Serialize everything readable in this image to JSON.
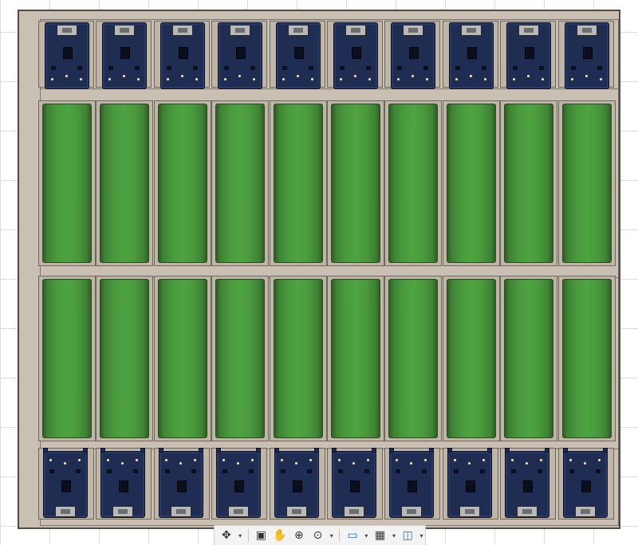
{
  "app": {
    "name": "CAD viewport",
    "background_color": "#ffffff",
    "grid_color": "#dcdcdc"
  },
  "model": {
    "tray_color": "#c9c0b3",
    "board_color": "#1f2d52",
    "cell_color": "#4ea341",
    "top_boards": 10,
    "bottom_boards": 10,
    "cell_rows": 2,
    "cells_per_row": 10
  },
  "navigation_toolbar": {
    "tools": [
      {
        "name": "orbit-tool",
        "icon": "orbit-icon",
        "glyph": "✥",
        "has_menu": true
      },
      {
        "name": "look-at-tool",
        "icon": "look-at-icon",
        "glyph": "▣",
        "has_menu": false
      },
      {
        "name": "pan-tool",
        "icon": "hand-icon",
        "glyph": "✋",
        "has_menu": false
      },
      {
        "name": "zoom-tool",
        "icon": "zoom-icon",
        "glyph": "⊕",
        "has_menu": false
      },
      {
        "name": "zoom-window-tool",
        "icon": "zoom-window-icon",
        "glyph": "⊙",
        "has_menu": true
      },
      {
        "name": "display-settings-tool",
        "icon": "monitor-icon",
        "glyph": "▭",
        "has_menu": true
      },
      {
        "name": "grid-settings-tool",
        "icon": "grid-icon",
        "glyph": "▦",
        "has_menu": true
      },
      {
        "name": "viewports-tool",
        "icon": "viewports-icon",
        "glyph": "◫",
        "has_menu": true
      }
    ],
    "menu_caret": "▾"
  }
}
